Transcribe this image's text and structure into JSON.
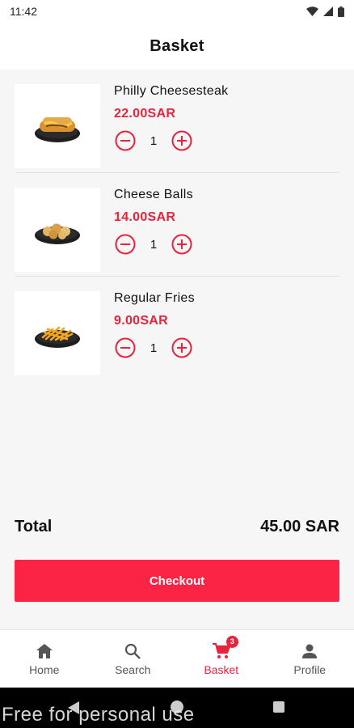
{
  "status_bar": {
    "time": "11:42"
  },
  "header": {
    "title": "Basket"
  },
  "items": [
    {
      "name": "Philly Cheesesteak",
      "price": "22.00SAR",
      "quantity": "1",
      "image_icon": "cheesesteak-image"
    },
    {
      "name": "Cheese Balls",
      "price": "14.00SAR",
      "quantity": "1",
      "image_icon": "cheese-balls-image"
    },
    {
      "name": "Regular Fries",
      "price": "9.00SAR",
      "quantity": "1",
      "image_icon": "fries-image"
    }
  ],
  "summary": {
    "total_label": "Total",
    "total_value": "45.00 SAR"
  },
  "checkout": {
    "label": "Checkout"
  },
  "nav": {
    "items": [
      {
        "label": "Home",
        "icon": "home-icon"
      },
      {
        "label": "Search",
        "icon": "search-icon"
      },
      {
        "label": "Basket",
        "icon": "cart-icon",
        "badge": "3",
        "active": true
      },
      {
        "label": "Profile",
        "icon": "person-icon"
      }
    ]
  },
  "watermark": "Free for personal use",
  "colors": {
    "accent": "#e8233b",
    "button": "#fb2445"
  }
}
